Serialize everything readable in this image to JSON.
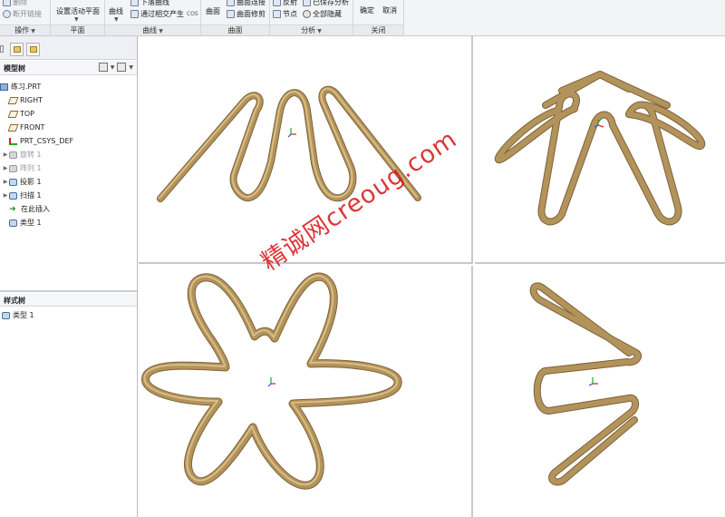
{
  "ribbon": {
    "groups": [
      {
        "label": "操作"
      },
      {
        "label": "平面"
      },
      {
        "label": "曲线"
      },
      {
        "label": "曲面"
      },
      {
        "label": "分析"
      },
      {
        "label": "关闭"
      }
    ],
    "ops": {
      "item1": "删除",
      "item2": "断开链接"
    },
    "plane": {
      "set_active": "设置活动平面"
    },
    "curves": {
      "curve": "曲线",
      "drop_curve": "下落曲线",
      "intersect_curve": "通过相交产生",
      "cos_label": "COS"
    },
    "surface": {
      "surface": "曲面",
      "surface_connect": "曲面连接",
      "surface_trim": "曲面修剪"
    },
    "analysis": {
      "reflect": "反射",
      "node": "节点",
      "curvature": "已保存分析",
      "hide_all": "全部隐藏"
    },
    "close": {
      "ok": "确定",
      "cancel": "取消"
    }
  },
  "model_tree": {
    "title": "模型树",
    "items": [
      {
        "label": "练习.PRT",
        "icon": "part-icon",
        "expandable": false,
        "dim": false
      },
      {
        "label": "RIGHT",
        "icon": "datum-plane-icon",
        "expandable": false,
        "dim": false
      },
      {
        "label": "TOP",
        "icon": "datum-plane-icon",
        "expandable": false,
        "dim": false
      },
      {
        "label": "FRONT",
        "icon": "datum-plane-icon",
        "expandable": false,
        "dim": false
      },
      {
        "label": "PRT_CSYS_DEF",
        "icon": "csys-icon",
        "expandable": false,
        "dim": false
      },
      {
        "label": "旋转 1",
        "icon": "revolve-icon",
        "expandable": true,
        "dim": true
      },
      {
        "label": "阵列 1",
        "icon": "pattern-icon",
        "expandable": true,
        "dim": true
      },
      {
        "label": "投影 1",
        "icon": "projection-icon",
        "expandable": true,
        "dim": false
      },
      {
        "label": "扫描 1",
        "icon": "sweep-icon",
        "expandable": true,
        "dim": false
      },
      {
        "label": "在此插入",
        "icon": "insert-here-icon",
        "expandable": false,
        "dim": false
      },
      {
        "label": "类型 1",
        "icon": "style-icon",
        "expandable": false,
        "dim": false
      }
    ]
  },
  "style_tree": {
    "title": "样式树",
    "items": [
      {
        "label": "类型 1"
      }
    ]
  },
  "watermark": "精诚网creoug.com",
  "colors": {
    "wire": "#b3935c",
    "wire_highlight": "#d9bd86",
    "wire_shadow": "#7d6336",
    "watermark": "#d61414"
  }
}
